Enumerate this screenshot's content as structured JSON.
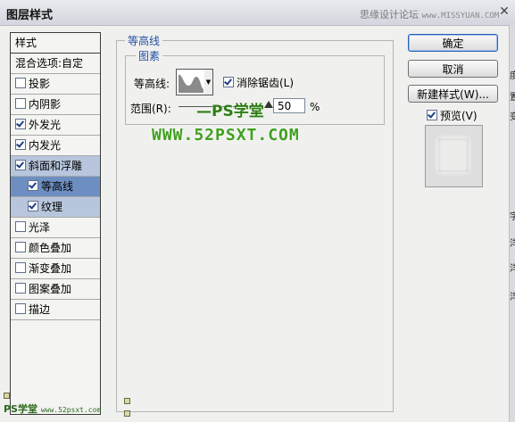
{
  "window": {
    "title": "图层样式",
    "watermark_text": "思缘设计论坛",
    "watermark_site": "www.MISSYUAN.COM"
  },
  "left_panel": {
    "header": "样式",
    "items": [
      {
        "label": "混合选项:自定",
        "checkbox": false,
        "checked": false,
        "indent": false,
        "selected": false
      },
      {
        "label": "投影",
        "checkbox": true,
        "checked": false,
        "indent": false,
        "selected": false
      },
      {
        "label": "内阴影",
        "checkbox": true,
        "checked": false,
        "indent": false,
        "selected": false
      },
      {
        "label": "外发光",
        "checkbox": true,
        "checked": true,
        "indent": false,
        "selected": false
      },
      {
        "label": "内发光",
        "checkbox": true,
        "checked": true,
        "indent": false,
        "selected": false
      },
      {
        "label": "斜面和浮雕",
        "checkbox": true,
        "checked": true,
        "indent": false,
        "selected": true
      },
      {
        "label": "等高线",
        "checkbox": true,
        "checked": true,
        "indent": true,
        "selected": "dark"
      },
      {
        "label": "纹理",
        "checkbox": true,
        "checked": true,
        "indent": true,
        "selected": true
      },
      {
        "label": "光泽",
        "checkbox": true,
        "checked": false,
        "indent": false,
        "selected": false
      },
      {
        "label": "颜色叠加",
        "checkbox": true,
        "checked": false,
        "indent": false,
        "selected": false
      },
      {
        "label": "渐变叠加",
        "checkbox": true,
        "checked": false,
        "indent": false,
        "selected": false
      },
      {
        "label": "图案叠加",
        "checkbox": true,
        "checked": false,
        "indent": false,
        "selected": false
      },
      {
        "label": "描边",
        "checkbox": true,
        "checked": false,
        "indent": false,
        "selected": false
      }
    ]
  },
  "main": {
    "group_title": "等高线",
    "subgroup_title": "图素",
    "contour_label": "等高线:",
    "anti_alias_label": "消除锯齿(L)",
    "anti_alias_checked": true,
    "range_label": "范围(R):",
    "range_value": "50",
    "range_unit": "%",
    "range_fraction": 0.5
  },
  "buttons": {
    "ok": "确定",
    "cancel": "取消",
    "new_style": "新建样式(W)...",
    "preview_label": "预览(V)",
    "preview_checked": true
  },
  "watermarks": {
    "ps_text": "PS学堂",
    "url_text": "WWW.52PSXT.COM",
    "bottom_ps": "PS学堂",
    "bottom_site": "www.52psxt.com"
  },
  "right_edge_chars": [
    "度",
    "置",
    "变",
    "字",
    "洋",
    "洋",
    "洋"
  ],
  "colors": {
    "accent_blue": "#2550a6",
    "selected_row": "#b7c6dc",
    "selected_row_dark": "#6d8ec0",
    "watermark_green": "#3fa01e"
  }
}
